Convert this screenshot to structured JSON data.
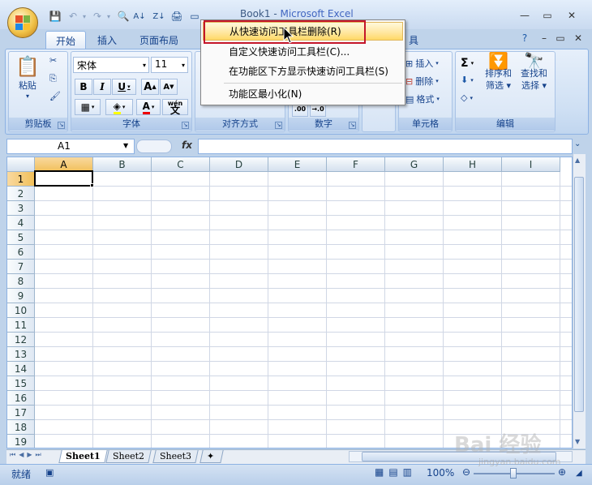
{
  "window": {
    "title": "Book1 - ",
    "app_name": "Microsoft Excel"
  },
  "ribbon_tabs": [
    "开始",
    "插入",
    "页面布局",
    "具"
  ],
  "clipboard": {
    "paste": "粘贴",
    "group": "剪贴板"
  },
  "font": {
    "name": "宋体",
    "size": "11",
    "group": "字体",
    "bold": "B",
    "italic": "I",
    "underline": "U",
    "grow": "A",
    "shrink": "A",
    "wen": "wén",
    "wen_char": "文"
  },
  "alignment": {
    "group": "对齐方式"
  },
  "number": {
    "group": "数字",
    "inc": ".00",
    "dec": "→.0"
  },
  "cells": {
    "insert": "插入",
    "delete": "删除",
    "format": "格式",
    "group": "单元格"
  },
  "editing": {
    "sum": "Σ",
    "sort": "排序和",
    "sort2": "筛选",
    "find": "查找和",
    "find2": "选择",
    "group": "编辑"
  },
  "namebox": "A1",
  "fx": "fx",
  "columns": [
    "A",
    "B",
    "C",
    "D",
    "E",
    "F",
    "G",
    "H",
    "I"
  ],
  "rows": [
    "1",
    "2",
    "3",
    "4",
    "5",
    "6",
    "7",
    "8",
    "9",
    "10",
    "11",
    "12",
    "13",
    "14",
    "15",
    "16",
    "17",
    "18",
    "19"
  ],
  "sheets": [
    "Sheet1",
    "Sheet2",
    "Sheet3"
  ],
  "status": {
    "ready": "就绪",
    "zoom": "100%"
  },
  "context_menu": [
    {
      "label": "从快速访问工具栏删除(R)"
    },
    {
      "label": "自定义快速访问工具栏(C)..."
    },
    {
      "label": "在功能区下方显示快速访问工具栏(S)"
    },
    {
      "label": "功能区最小化(N)"
    }
  ],
  "watermark": {
    "text": "Bai 经验",
    "url": "jingyan.baidu.com"
  },
  "colors": {
    "accent": "#15428b",
    "highlight": "#ffe69d",
    "red_frame": "#c4162a"
  }
}
